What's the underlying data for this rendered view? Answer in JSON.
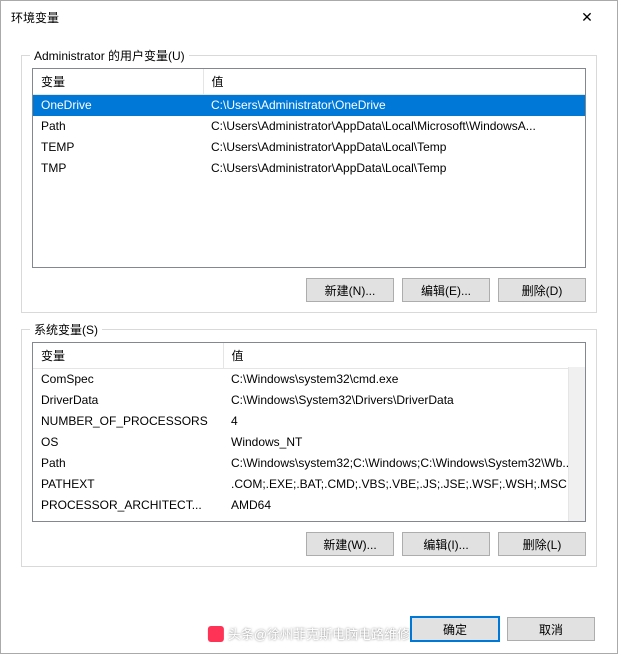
{
  "window": {
    "title": "环境变量"
  },
  "user_section": {
    "label": "Administrator 的用户变量(U)",
    "columns": {
      "variable": "变量",
      "value": "值"
    },
    "rows": [
      {
        "name": "OneDrive",
        "value": "C:\\Users\\Administrator\\OneDrive",
        "selected": true
      },
      {
        "name": "Path",
        "value": "C:\\Users\\Administrator\\AppData\\Local\\Microsoft\\WindowsA...",
        "selected": false
      },
      {
        "name": "TEMP",
        "value": "C:\\Users\\Administrator\\AppData\\Local\\Temp",
        "selected": false
      },
      {
        "name": "TMP",
        "value": "C:\\Users\\Administrator\\AppData\\Local\\Temp",
        "selected": false
      }
    ],
    "buttons": {
      "new": "新建(N)...",
      "edit": "编辑(E)...",
      "delete": "删除(D)"
    }
  },
  "system_section": {
    "label": "系统变量(S)",
    "columns": {
      "variable": "变量",
      "value": "值"
    },
    "rows": [
      {
        "name": "ComSpec",
        "value": "C:\\Windows\\system32\\cmd.exe"
      },
      {
        "name": "DriverData",
        "value": "C:\\Windows\\System32\\Drivers\\DriverData"
      },
      {
        "name": "NUMBER_OF_PROCESSORS",
        "value": "4"
      },
      {
        "name": "OS",
        "value": "Windows_NT"
      },
      {
        "name": "Path",
        "value": "C:\\Windows\\system32;C:\\Windows;C:\\Windows\\System32\\Wb..."
      },
      {
        "name": "PATHEXT",
        "value": ".COM;.EXE;.BAT;.CMD;.VBS;.VBE;.JS;.JSE;.WSF;.WSH;.MSC"
      },
      {
        "name": "PROCESSOR_ARCHITECT...",
        "value": "AMD64"
      }
    ],
    "buttons": {
      "new": "新建(W)...",
      "edit": "编辑(I)...",
      "delete": "删除(L)"
    }
  },
  "dialog_buttons": {
    "ok": "确定",
    "cancel": "取消"
  },
  "watermark": "头条@徐州菲克斯电脑电路维修"
}
